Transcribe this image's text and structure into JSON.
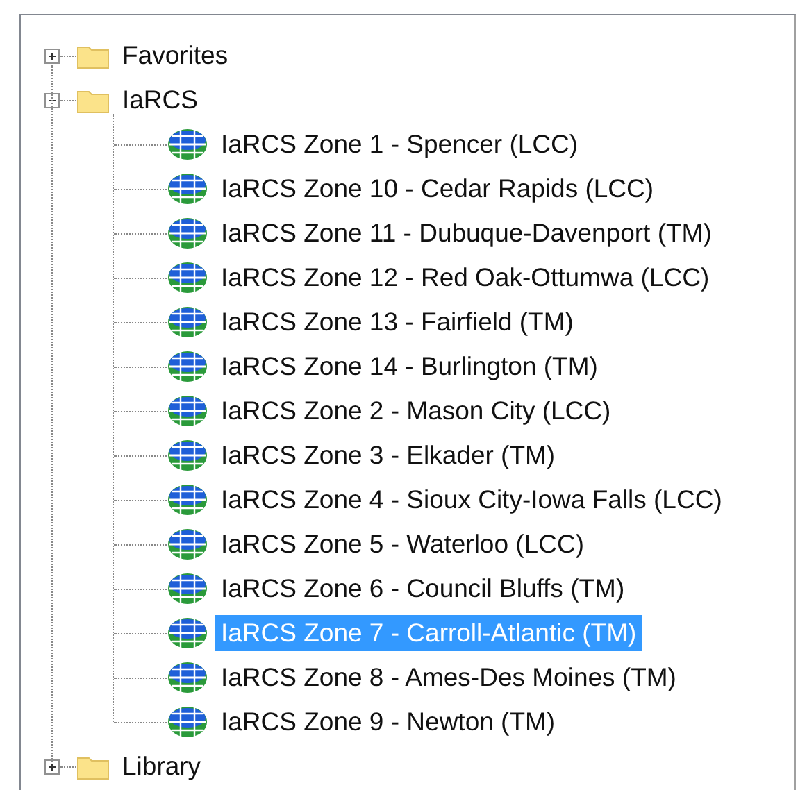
{
  "tree": [
    {
      "label": "Favorites",
      "kind": "folder",
      "expanded": false,
      "selected": false
    },
    {
      "label": "IaRCS",
      "kind": "folder",
      "expanded": true,
      "selected": false,
      "children": [
        {
          "label": "IaRCS Zone 1 - Spencer (LCC)",
          "kind": "projection",
          "selected": false
        },
        {
          "label": "IaRCS Zone 10 - Cedar Rapids (LCC)",
          "kind": "projection",
          "selected": false
        },
        {
          "label": "IaRCS Zone 11 - Dubuque-Davenport (TM)",
          "kind": "projection",
          "selected": false
        },
        {
          "label": "IaRCS Zone 12 - Red Oak-Ottumwa (LCC)",
          "kind": "projection",
          "selected": false
        },
        {
          "label": "IaRCS Zone 13 - Fairfield (TM)",
          "kind": "projection",
          "selected": false
        },
        {
          "label": "IaRCS Zone 14 - Burlington (TM)",
          "kind": "projection",
          "selected": false
        },
        {
          "label": "IaRCS Zone 2 - Mason City (LCC)",
          "kind": "projection",
          "selected": false
        },
        {
          "label": "IaRCS Zone 3 - Elkader (TM)",
          "kind": "projection",
          "selected": false
        },
        {
          "label": "IaRCS Zone 4 - Sioux City-Iowa Falls (LCC)",
          "kind": "projection",
          "selected": false
        },
        {
          "label": "IaRCS Zone 5 - Waterloo (LCC)",
          "kind": "projection",
          "selected": false
        },
        {
          "label": "IaRCS Zone 6 - Council Bluffs (TM)",
          "kind": "projection",
          "selected": false
        },
        {
          "label": "IaRCS Zone 7 - Carroll-Atlantic (TM)",
          "kind": "projection",
          "selected": true
        },
        {
          "label": "IaRCS Zone 8 - Ames-Des Moines (TM)",
          "kind": "projection",
          "selected": false
        },
        {
          "label": "IaRCS Zone 9 - Newton (TM)",
          "kind": "projection",
          "selected": false
        }
      ]
    },
    {
      "label": "Library",
      "kind": "folder",
      "expanded": false,
      "selected": false
    }
  ]
}
